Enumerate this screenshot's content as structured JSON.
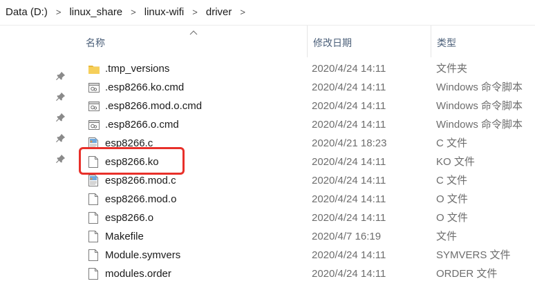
{
  "breadcrumb": {
    "items": [
      "Data (D:)",
      "linux_share",
      "linux-wifi",
      "driver"
    ],
    "separator": ">"
  },
  "columns": {
    "name": "名称",
    "date": "修改日期",
    "type": "类型"
  },
  "files": [
    {
      "name": ".tmp_versions",
      "date": "2020/4/24 14:11",
      "type": "文件夹",
      "icon": "folder-icon"
    },
    {
      "name": ".esp8266.ko.cmd",
      "date": "2020/4/24 14:11",
      "type": "Windows 命令脚本",
      "icon": "cmd-script-icon"
    },
    {
      "name": ".esp8266.mod.o.cmd",
      "date": "2020/4/24 14:11",
      "type": "Windows 命令脚本",
      "icon": "cmd-script-icon"
    },
    {
      "name": ".esp8266.o.cmd",
      "date": "2020/4/24 14:11",
      "type": "Windows 命令脚本",
      "icon": "cmd-script-icon"
    },
    {
      "name": "esp8266.c",
      "date": "2020/4/21 18:23",
      "type": "C 文件",
      "icon": "c-source-icon"
    },
    {
      "name": "esp8266.ko",
      "date": "2020/4/24 14:11",
      "type": "KO 文件",
      "icon": "file-icon"
    },
    {
      "name": "esp8266.mod.c",
      "date": "2020/4/24 14:11",
      "type": "C 文件",
      "icon": "c-source-icon"
    },
    {
      "name": "esp8266.mod.o",
      "date": "2020/4/24 14:11",
      "type": "O 文件",
      "icon": "file-icon"
    },
    {
      "name": "esp8266.o",
      "date": "2020/4/24 14:11",
      "type": "O 文件",
      "icon": "file-icon"
    },
    {
      "name": "Makefile",
      "date": "2020/4/7 16:19",
      "type": "文件",
      "icon": "file-icon"
    },
    {
      "name": "Module.symvers",
      "date": "2020/4/24 14:11",
      "type": "SYMVERS 文件",
      "icon": "file-icon"
    },
    {
      "name": "modules.order",
      "date": "2020/4/24 14:11",
      "type": "ORDER 文件",
      "icon": "file-icon"
    }
  ],
  "highlight": {
    "target": "esp8266.ko",
    "color": "#e8302a"
  },
  "quick_access_pins": 5,
  "colors": {
    "header_text": "#4c607a",
    "secondary_text": "#6d6d6d",
    "folder": "#f0c24a"
  }
}
